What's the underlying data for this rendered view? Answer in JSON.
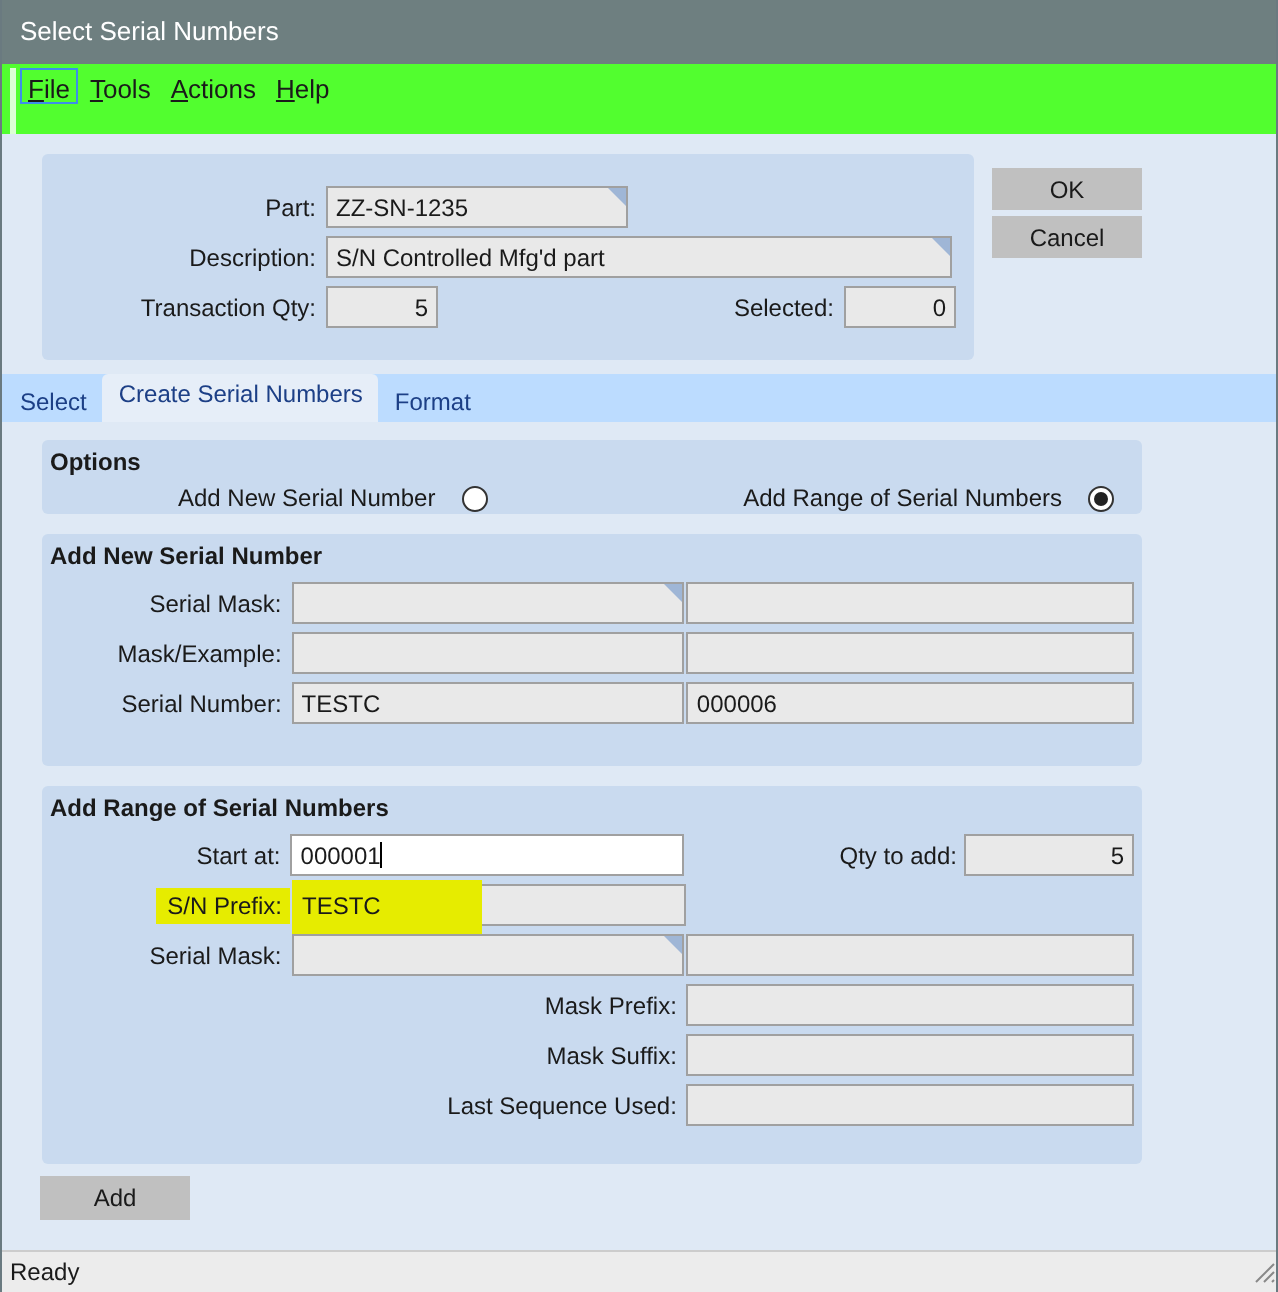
{
  "window": {
    "title": "Select Serial Numbers"
  },
  "menu": [
    {
      "label": "File",
      "focused": true
    },
    {
      "label": "Tools",
      "focused": false
    },
    {
      "label": "Actions",
      "focused": false
    },
    {
      "label": "Help",
      "focused": false
    }
  ],
  "header": {
    "part": {
      "label": "Part:",
      "value": "ZZ-SN-1235",
      "flagged": true
    },
    "description": {
      "label": "Description:",
      "value": "S/N Controlled Mfg'd part",
      "flagged": true
    },
    "transaction_qty": {
      "label": "Transaction Qty:",
      "value": "5"
    },
    "selected": {
      "label": "Selected:",
      "value": "0"
    }
  },
  "buttons": [
    "OK",
    "Cancel"
  ],
  "tabs": [
    {
      "label": "Select",
      "selected": false
    },
    {
      "label": "Create Serial Numbers",
      "selected": true
    },
    {
      "label": "Format",
      "selected": false
    }
  ],
  "options": {
    "title": "Options",
    "choices": [
      {
        "label": "Add New Serial Number",
        "selected": false
      },
      {
        "label": "Add Range of Serial Numbers",
        "selected": true
      }
    ]
  },
  "new_serial": {
    "title": "Add New Serial Number",
    "rows": [
      {
        "kind": "pair",
        "label": "Serial Mask:",
        "flagged": true
      },
      {
        "kind": "pair",
        "label": "Mask/Example:",
        "flagged": false
      },
      {
        "kind": "pair",
        "label": "Serial Number:",
        "flagged": false,
        "value": "TESTC",
        "second_value": "000006"
      }
    ]
  },
  "range": {
    "title": "Add Range of Serial Numbers",
    "rows": [
      {
        "kind": "single",
        "label": "Start at:",
        "value": "000001",
        "editable": true,
        "highlighted": false,
        "side_label": "Qty to add:",
        "side_value": "5"
      },
      {
        "kind": "single",
        "label": "S/N Prefix:",
        "value": "TESTC",
        "editable": false,
        "highlighted": true
      },
      {
        "kind": "pair",
        "label": "Serial Mask:",
        "flagged": true
      },
      {
        "kind": "right",
        "label": "Mask Prefix:"
      },
      {
        "kind": "right",
        "label": "Mask Suffix:"
      },
      {
        "kind": "right",
        "label": "Last Sequence Used:"
      }
    ]
  },
  "add_button": "Add",
  "status_bar": "Ready"
}
